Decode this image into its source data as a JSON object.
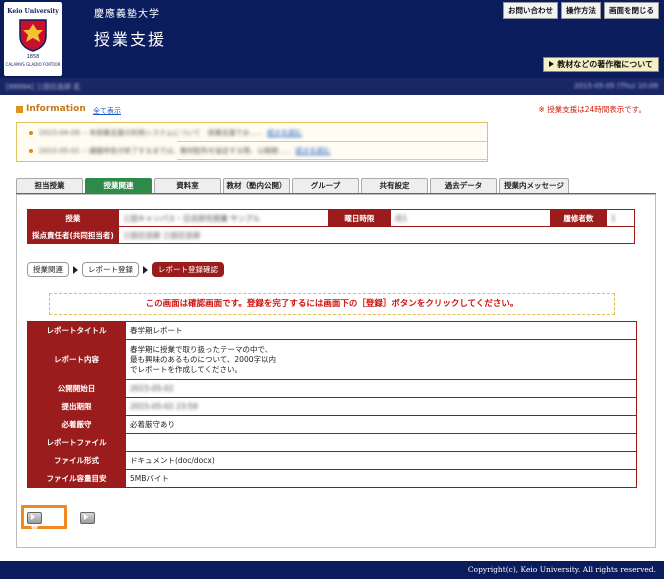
{
  "header": {
    "logo_top": "Keio University",
    "logo_year": "1858",
    "logo_motto": "CALAMVS GLADIO FORTIOR",
    "university": "慶應義塾大学",
    "system_title": "授業支援",
    "buttons": [
      "お問い合わせ",
      "操作方法",
      "画面を閉じる"
    ],
    "copyright_button": "教材などの著作権について"
  },
  "subbar": {
    "left_text": "[99994] 三田日吉研 花",
    "right_text": "2015-05-05 (Thu) 10:09"
  },
  "info": {
    "title": "Information",
    "show_all": "全て表示",
    "hours_note": "※ 授業支援は24時間表示です。",
    "items": [
      {
        "text": "2015-04-09 -- 本授業支援の利用システムについて　授業支援でお......",
        "link": "続きを読む"
      },
      {
        "text": "2015-05-01 -- 課題申告が終了するまでは、教材配布を設定する際、公開期......",
        "link": "続きを読む"
      }
    ]
  },
  "tabs": [
    "担当授業",
    "授業関連",
    "資料室",
    "教材（塾内公開）",
    "グループ",
    "共有設定",
    "過去データ",
    "授業内メッセージ"
  ],
  "active_tab": 1,
  "course": {
    "label_course": "授業",
    "value_course": "三田キャンパス・日吉研究授業 サンプル",
    "label_day": "曜日時限",
    "value_day": "月1",
    "label_students": "履修者数",
    "value_students": "1",
    "label_grader": "採点責任者(共同担当者)",
    "value_grader": "三田日吉研 三田日吉研"
  },
  "breadcrumb": [
    "授業関連",
    "レポート登録",
    "レポート登録確認"
  ],
  "confirm_message": "この画面は確認画面です。登録を完了するには画面下の［登録］ボタンをクリックしてください。",
  "report": {
    "rows": [
      {
        "label": "レポートタイトル",
        "value": "春学期レポート"
      },
      {
        "label": "レポート内容",
        "lines": [
          "春学期に授業で取り扱ったテーマの中で、",
          "最も興味のあるものについて、2000字以内",
          "でレポートを作成してください。"
        ]
      },
      {
        "label": "公開開始日",
        "value": "2015-05-02"
      },
      {
        "label": "提出期限",
        "value": "2015-05-02 23:59"
      },
      {
        "label": "必着厳守",
        "value": "必着厳守あり"
      },
      {
        "label": "レポートファイル",
        "value": ""
      },
      {
        "label": "ファイル形式",
        "value": "ドキュメント(doc/docx)"
      },
      {
        "label": "ファイル容量目安",
        "value": "5MBバイト"
      }
    ]
  },
  "buttons": {
    "register": "登録",
    "back": "戻る"
  },
  "footer": {
    "copyright": "Copyright(c), Keio University. All rights reserved."
  },
  "colors": {
    "navy": "#0b1c5c",
    "maroon": "#9a1c1c",
    "active_tab": "#2e8a48",
    "highlight": "#f08a20",
    "alert_red": "#d01010"
  }
}
